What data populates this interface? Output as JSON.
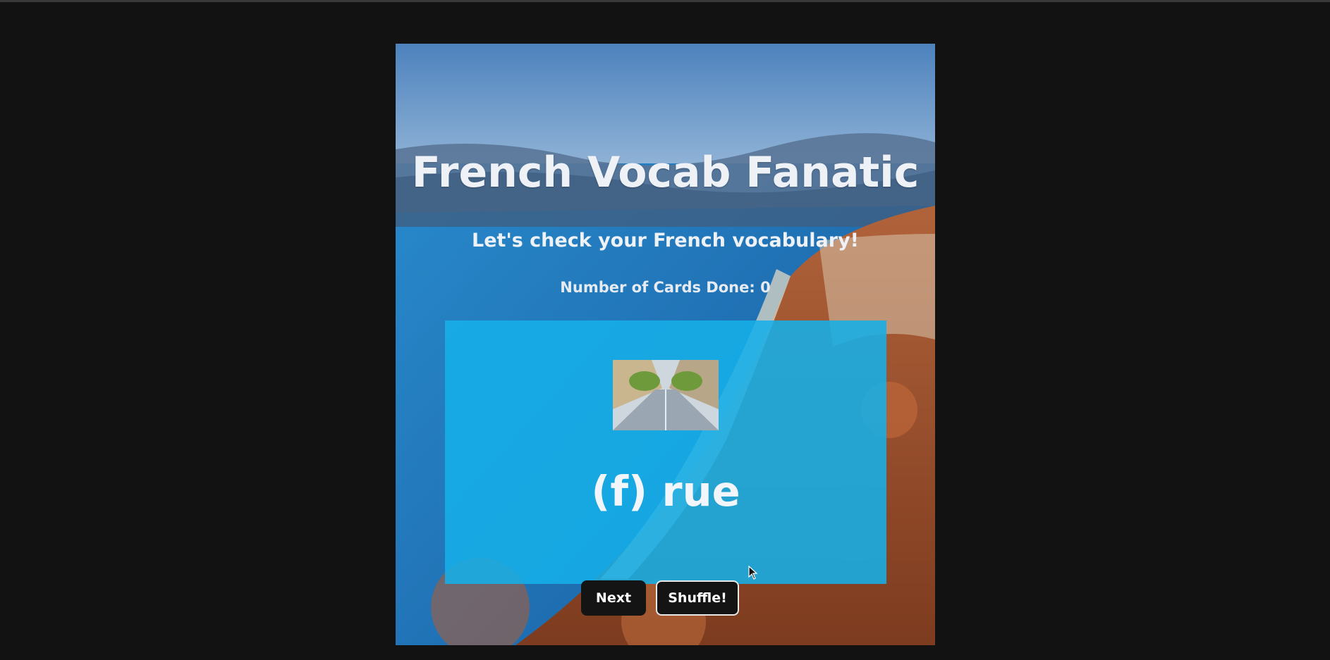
{
  "app": {
    "title": "French Vocab Fanatic",
    "subtitle": "Let's check your French vocabulary!",
    "counter_label": "Number of Cards Done: 0",
    "background_image": "aerial view of a coastal city with blue sea and orange rooftops"
  },
  "card": {
    "word": "(f) rue",
    "image_alt": "a paved street lined with trees and buildings",
    "color": "#16afe8"
  },
  "buttons": {
    "next_label": "Next",
    "shuffle_label": "Shuffle!"
  },
  "colors": {
    "page_background": "#121212",
    "button_background": "#141414"
  }
}
